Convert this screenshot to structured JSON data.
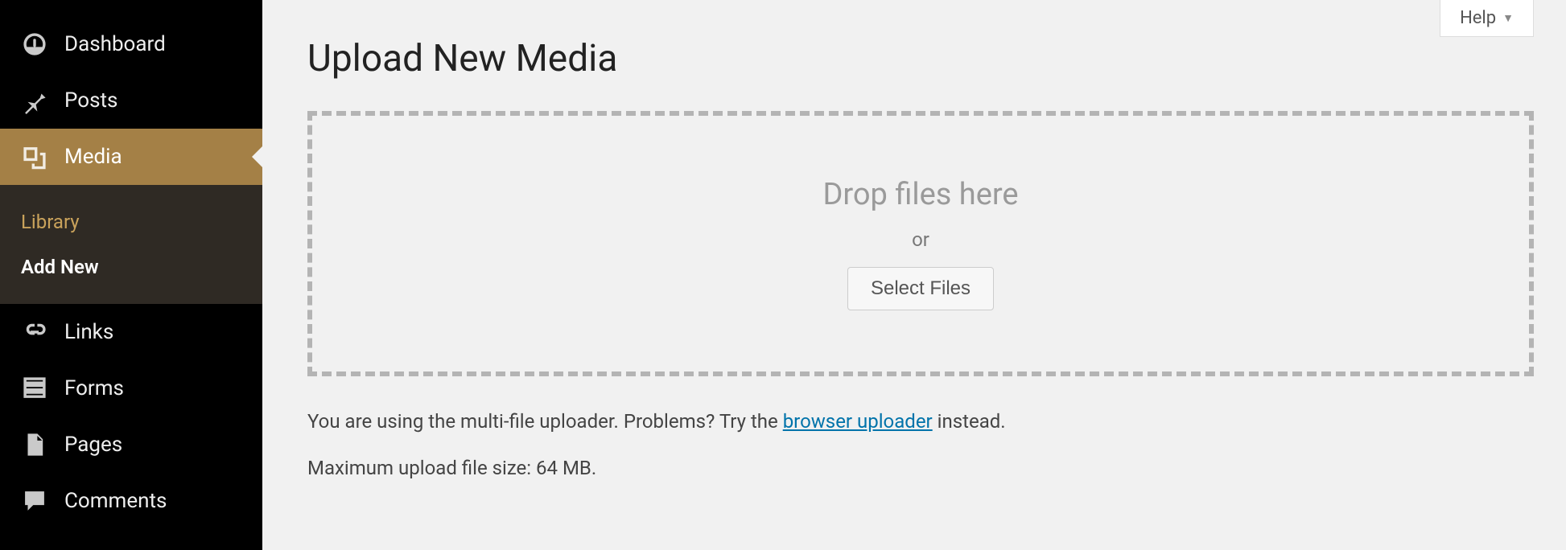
{
  "sidebar": {
    "items": [
      {
        "label": "Dashboard"
      },
      {
        "label": "Posts"
      },
      {
        "label": "Media"
      },
      {
        "label": "Links"
      },
      {
        "label": "Forms"
      },
      {
        "label": "Pages"
      },
      {
        "label": "Comments"
      }
    ],
    "media_submenu": {
      "library": "Library",
      "add_new": "Add New"
    }
  },
  "header": {
    "help_label": "Help"
  },
  "main": {
    "title": "Upload New Media",
    "drop_label": "Drop files here",
    "or_label": "or",
    "select_files_label": "Select Files",
    "info_pre": "You are using the multi-file uploader. Problems? Try the ",
    "info_link": "browser uploader",
    "info_post": " instead.",
    "maxsize_line": "Maximum upload file size: 64 MB."
  }
}
